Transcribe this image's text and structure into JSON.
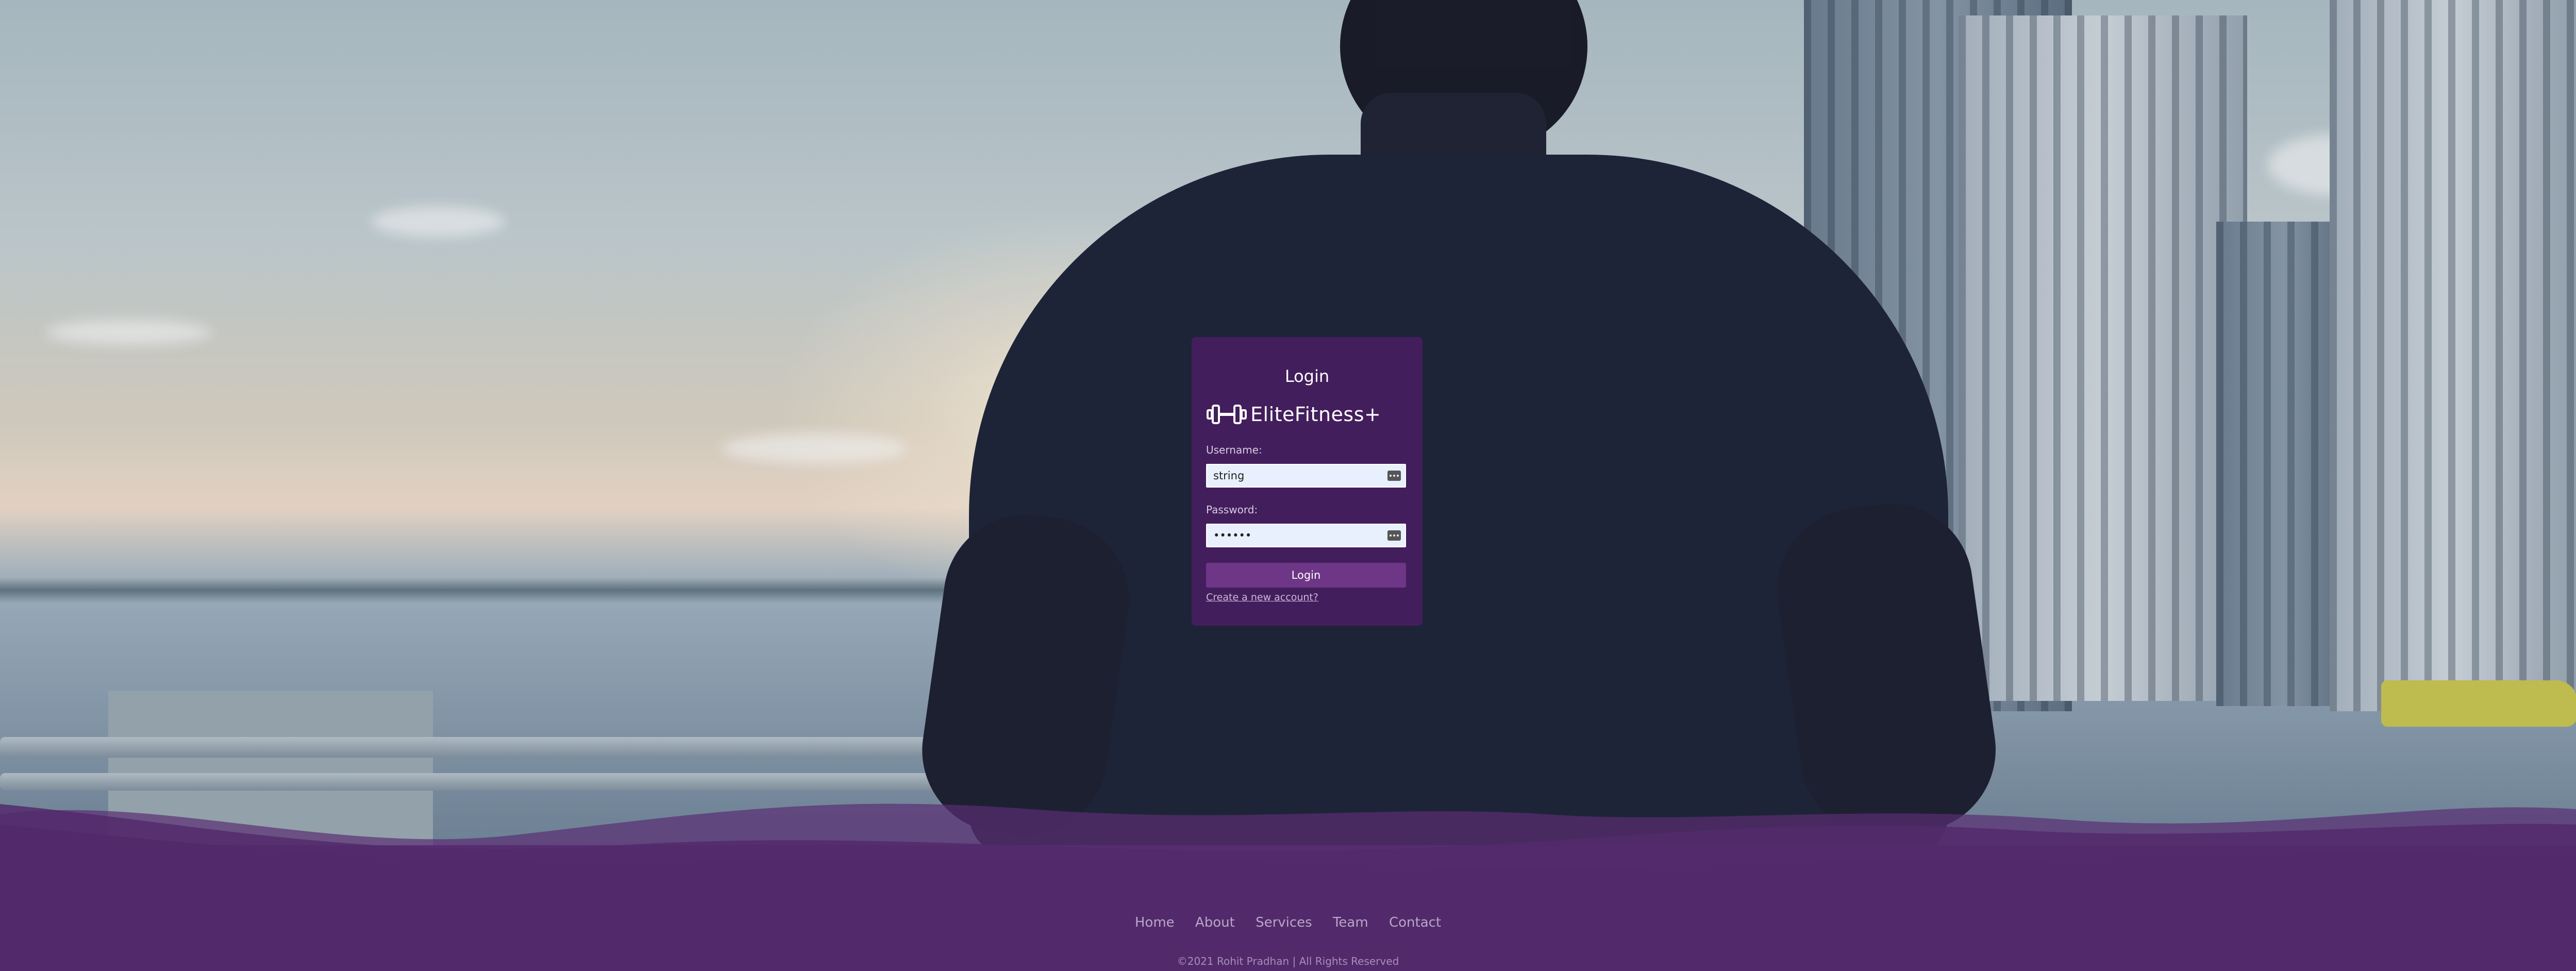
{
  "login_card": {
    "title": "Login",
    "brand_name": "EliteFitness+",
    "brand_icon": "dumbbell-icon",
    "username_label": "Username:",
    "username_value": "string",
    "password_label": "Password:",
    "password_value": "••••••",
    "login_button": "Login",
    "create_account_link": "Create a new account?"
  },
  "footer": {
    "nav": [
      "Home",
      "About",
      "Services",
      "Team",
      "Contact"
    ],
    "copyright": "©2021 Rohit Pradhan | All Rights Reserved"
  },
  "colors": {
    "primary_purple": "#522a6b",
    "card_bg": "#461e5f",
    "button_bg": "#6e3686",
    "input_bg": "#e8f0fe"
  }
}
